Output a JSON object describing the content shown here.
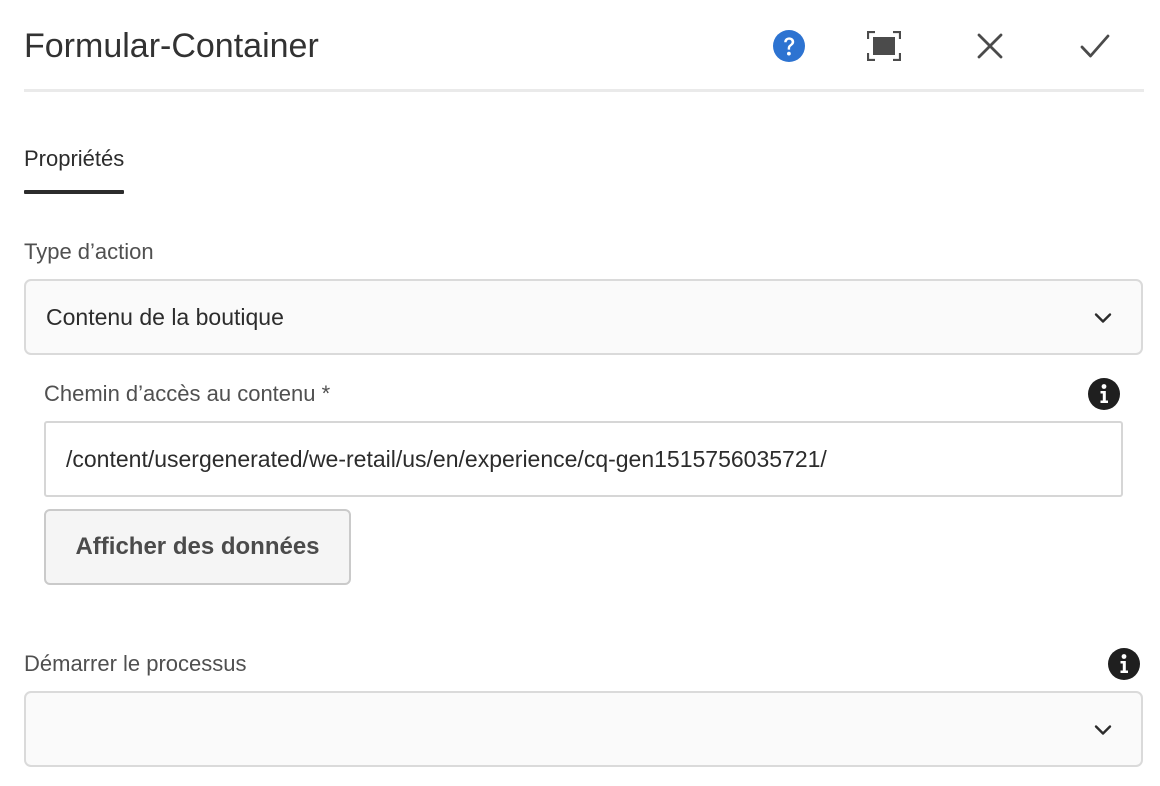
{
  "dialog": {
    "title": "Formular-Container",
    "actions": {
      "help_icon": "help-circle-icon",
      "fullscreen_icon": "fullscreen-icon",
      "close_icon": "close-icon",
      "done_icon": "checkmark-icon"
    }
  },
  "tabs": [
    {
      "label": "Propriétés",
      "selected": true
    }
  ],
  "form": {
    "action_type": {
      "label": "Type d’action",
      "selected": "Contenu de la boutique"
    },
    "content_path": {
      "label": "Chemin d’accès au contenu *",
      "value": "/content/usergenerated/we-retail/us/en/experience/cq-gen1515756035721/",
      "info_icon": "info-icon"
    },
    "view_data_button": {
      "label": "Afficher des données"
    },
    "start_workflow": {
      "label": "Démarrer le processus",
      "selected": "",
      "info_icon": "info-icon"
    }
  },
  "colors": {
    "accent_blue": "#2d73d1",
    "text": "#2c2c2c",
    "label": "#505050",
    "border": "#dadada"
  }
}
